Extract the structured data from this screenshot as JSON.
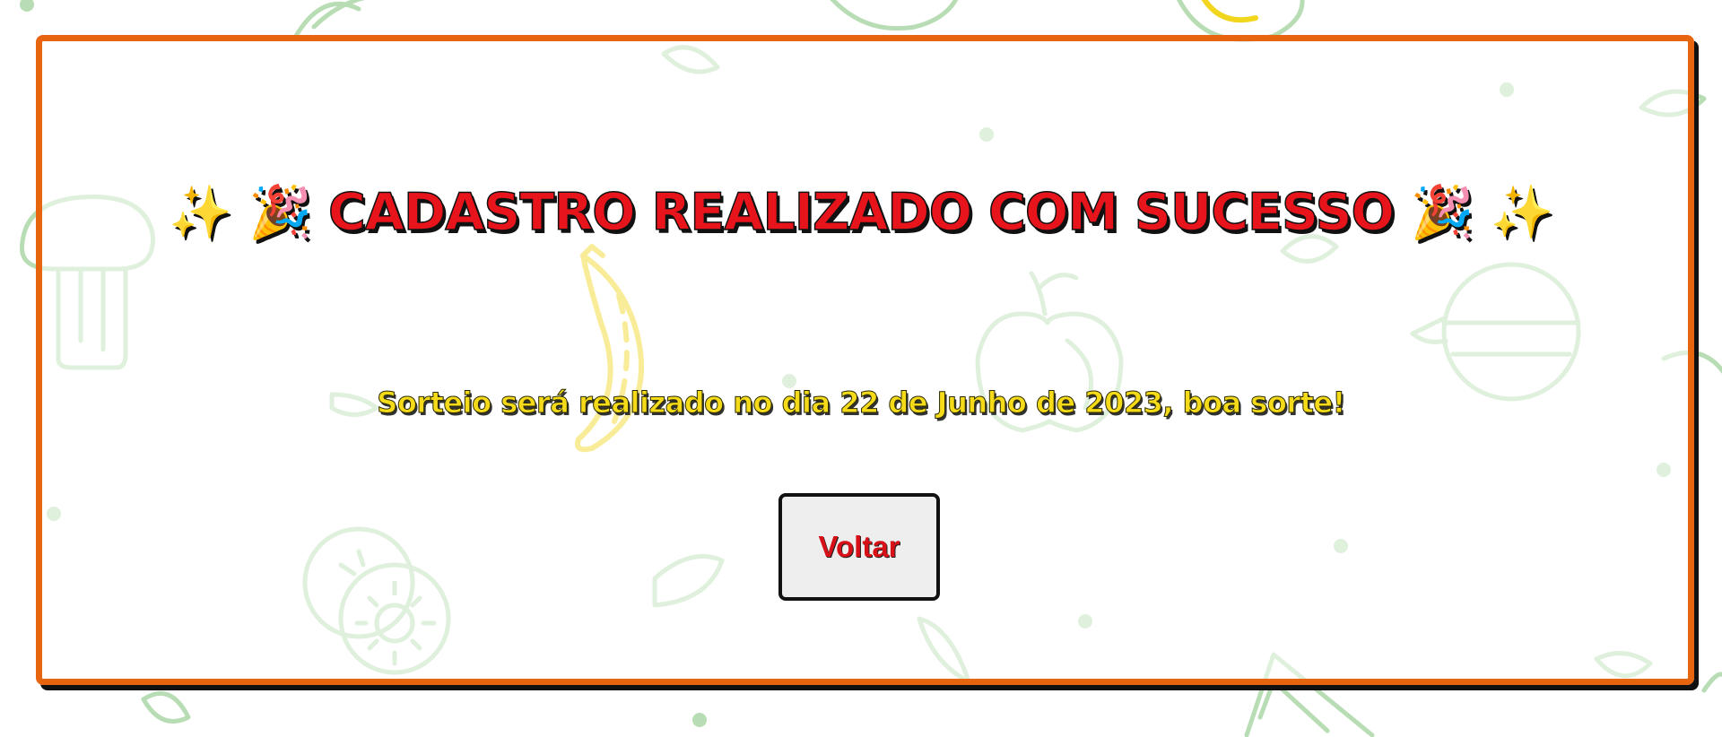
{
  "page": {
    "title": "✨ 🎉 CADASTRO REALIZADO COM SUCESSO 🎉 ✨",
    "subtitle": "Sorteio será realizado no dia 22 de Junho de 2023, boa sorte!",
    "back_button_label": "Voltar"
  },
  "colors": {
    "card_border": "#e8650f",
    "title_text": "#e8141c",
    "subtitle_text": "#f5da1a",
    "button_text": "#d81018",
    "button_bg": "#eeeeee",
    "background_pattern": "#b8ddb4",
    "banana": "#f2d61e"
  },
  "icons": [
    "sparkles-icon",
    "party-popper-icon"
  ],
  "background_illustrations": [
    "mushroom-icon",
    "banana-icon",
    "apple-icon",
    "pomegranate-icon",
    "kiwi-icon",
    "leaf-icon",
    "watermelon-icon",
    "lemon-icon"
  ]
}
